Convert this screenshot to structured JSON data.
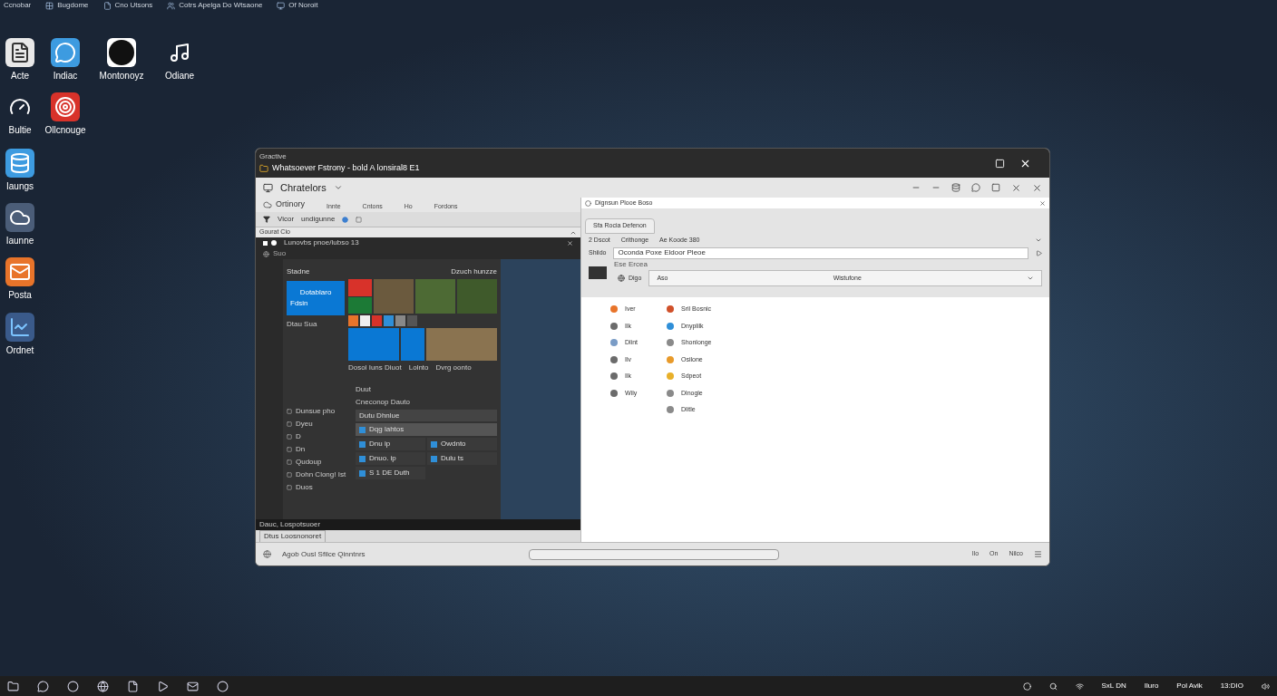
{
  "top_strip": [
    {
      "kind": "none",
      "label": "Ccnobar"
    },
    {
      "kind": "grid",
      "label": "Bugdome"
    },
    {
      "kind": "page",
      "label": "Cno Utsons"
    },
    {
      "kind": "people",
      "label": "Cotrs Apelga Do Wtsaone"
    },
    {
      "kind": "screen",
      "label": "Of Noroit"
    }
  ],
  "desktop_icons": [
    {
      "kind": "document",
      "label": "Acte"
    },
    {
      "kind": "chat",
      "label": "Indiac"
    },
    {
      "kind": "letter",
      "label": "Montonoyz"
    },
    {
      "kind": "music",
      "label": "Odiane"
    },
    {
      "kind": "gauge",
      "label": "Bultie"
    },
    {
      "kind": "target",
      "label": "Ollcnouge"
    },
    {
      "kind": "database",
      "label": "Iaungs"
    },
    {
      "kind": "cloud",
      "label": "Iaunne"
    },
    {
      "kind": "mail",
      "label": "Posta"
    },
    {
      "kind": "chart",
      "label": "Ordnet"
    }
  ],
  "window": {
    "caption": "Gractive",
    "title": "Whatsoever Fstrony - bold A lonsiral8 E1",
    "app_title": "Chratelors",
    "menu_lead": "Ortinory",
    "menu": [
      "Innte",
      "Cntons",
      "Ho",
      "Fordons"
    ],
    "filter_label": "Vicor",
    "filter_value": "undigunne",
    "left_pane": {
      "header": "Gourat Cio",
      "inner_title": "Lunovbs pnoe/lubso 13",
      "inner_sub": "Suo",
      "left_heading": "Stadne",
      "big_tile": "Dotablaro",
      "big_tile_sub": "Fdsin",
      "pinned": "Dtau Sua",
      "right_heading": "Dzuch hunzze",
      "tile_captions": [
        "Dosol Iuns Diuot",
        "Lolnto",
        "Dvrg oonto"
      ],
      "group_label": "Duut",
      "group_sub": "Cneconop Dauto",
      "group_field": "Dutu Dhnlue",
      "app_rows": [
        {
          "label": "Dqg lahtos",
          "selected": true
        },
        {
          "label": "Dnu ip",
          "selected": false
        },
        {
          "label": "Owdnto",
          "selected": false
        },
        {
          "label": "Dnuo. ip",
          "selected": false
        },
        {
          "label": "Dulu ts",
          "selected": false
        },
        {
          "label": "S 1 DE Duth",
          "selected": false
        }
      ],
      "side_list": [
        "Dunsue pho",
        "Dyeu",
        "D",
        "Dn",
        "Qudoup",
        "Dohn Clong! Ist",
        "Duos"
      ],
      "inner_status": "Dauc, Lospotsuoer",
      "status_tab": "Dtus Loosnonoret"
    },
    "right_pane": {
      "header": "Dignsun Plooe Boso",
      "tab": "Sfa Rocia Defenon",
      "row_label": "2 Dscot",
      "row_value": "Crithonge",
      "row_extra": "Ae Koode 380",
      "field_label": "Shiido",
      "field_value": "Oconda Poxe Eldoor Pleoe",
      "group_label": "Ese Ercea",
      "group_button": "Digo",
      "dropdown_lead": "Aso",
      "dropdown_value": "Wistufone",
      "left_items": [
        {
          "label": "Iver",
          "color": "#e8742a"
        },
        {
          "label": "Ilk",
          "color": "#6b6b6b"
        },
        {
          "label": "Dlint",
          "color": "#7a9cc6"
        },
        {
          "label": "Ilv",
          "color": "#6b6b6b"
        },
        {
          "label": "Ilk",
          "color": "#6b6b6b"
        },
        {
          "label": "Wily",
          "color": "#6b6b6b"
        }
      ],
      "right_items": [
        {
          "label": "Sril Bosnic",
          "color": "#d0502a"
        },
        {
          "label": "Dnyplilk",
          "color": "#2f8fd8"
        },
        {
          "label": "Shonlonge",
          "color": "#8a8a8a"
        },
        {
          "label": "Osilone",
          "color": "#e89a2a"
        },
        {
          "label": "Sdpeot",
          "color": "#e8b02a"
        },
        {
          "label": "Dlnogle",
          "color": "#8a8a8a"
        },
        {
          "label": "Dlitle",
          "color": "#8a8a8a"
        }
      ]
    },
    "status": "Agob Ousl Sfilce Qinntnrs",
    "status_right": [
      "Ilo",
      "On",
      "Nilco"
    ]
  },
  "taskbar": {
    "tray": [
      "SxL DN",
      "Iluro",
      "Pol Avik",
      "13:DIO"
    ]
  }
}
